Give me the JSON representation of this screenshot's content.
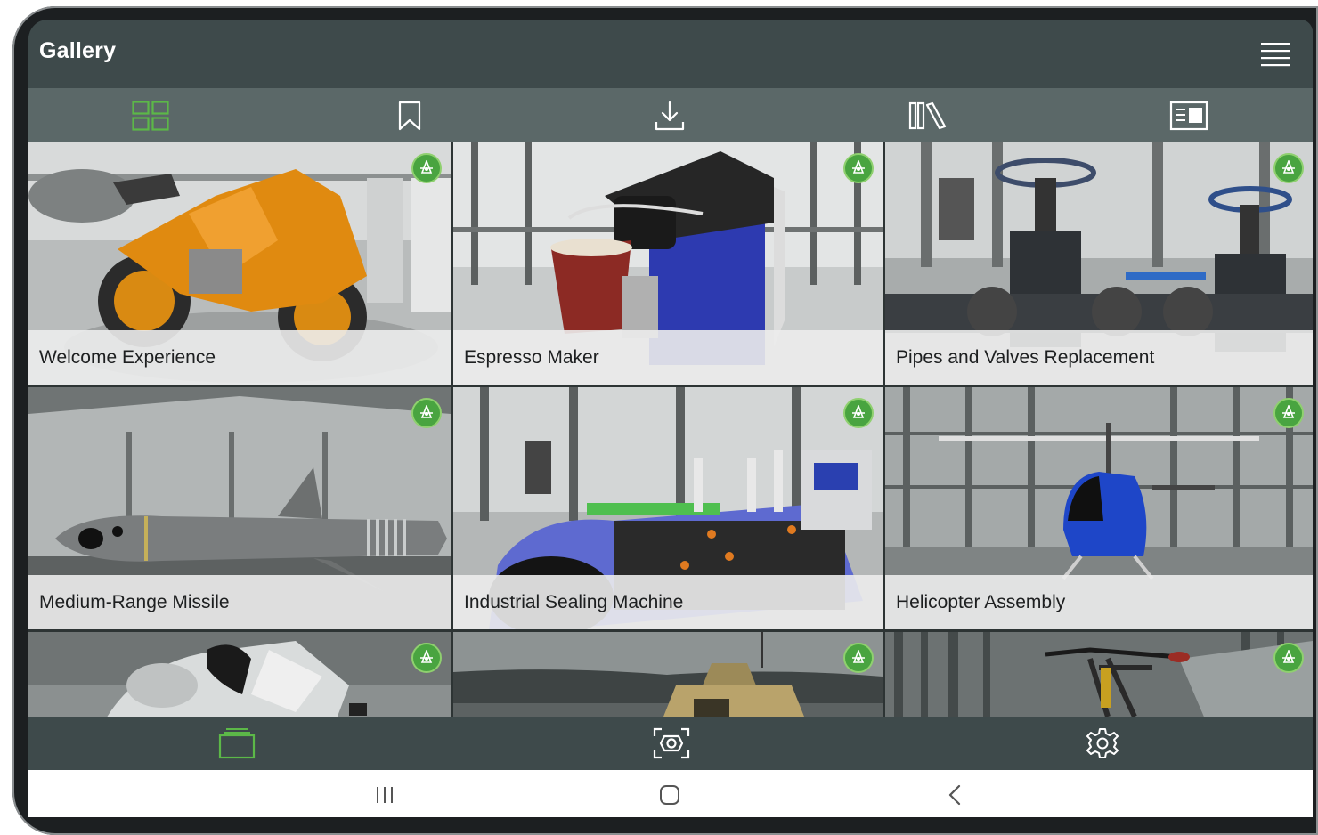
{
  "app": {
    "title": "Gallery",
    "accent_color": "#5cb848"
  },
  "header": {
    "menu_icon": "hamburger-menu-icon"
  },
  "tabs": [
    {
      "name": "gallery-grid",
      "icon": "grid-icon",
      "active": true
    },
    {
      "name": "bookmarks",
      "icon": "bookmark-icon",
      "active": false
    },
    {
      "name": "downloads",
      "icon": "download-icon",
      "active": false
    },
    {
      "name": "library",
      "icon": "library-icon",
      "active": false
    },
    {
      "name": "list-view",
      "icon": "card-list-icon",
      "active": false
    }
  ],
  "gallery": {
    "items": [
      {
        "title": "Welcome Experience"
      },
      {
        "title": "Espresso Maker"
      },
      {
        "title": "Pipes and Valves Replacement"
      },
      {
        "title": "Medium-Range Missile"
      },
      {
        "title": "Industrial Sealing Machine"
      },
      {
        "title": "Helicopter Assembly"
      },
      {
        "title": ""
      },
      {
        "title": ""
      },
      {
        "title": ""
      }
    ],
    "badge_icon": "experience-badge-icon"
  },
  "bottom_nav": [
    {
      "name": "experiences",
      "icon": "stack-cards-icon",
      "active": true
    },
    {
      "name": "scan",
      "icon": "scan-icon",
      "active": false
    },
    {
      "name": "settings",
      "icon": "gear-icon",
      "active": false
    }
  ],
  "system_nav": [
    {
      "name": "recents",
      "icon": "recents-icon"
    },
    {
      "name": "home",
      "icon": "home-icon"
    },
    {
      "name": "back",
      "icon": "back-icon"
    }
  ]
}
